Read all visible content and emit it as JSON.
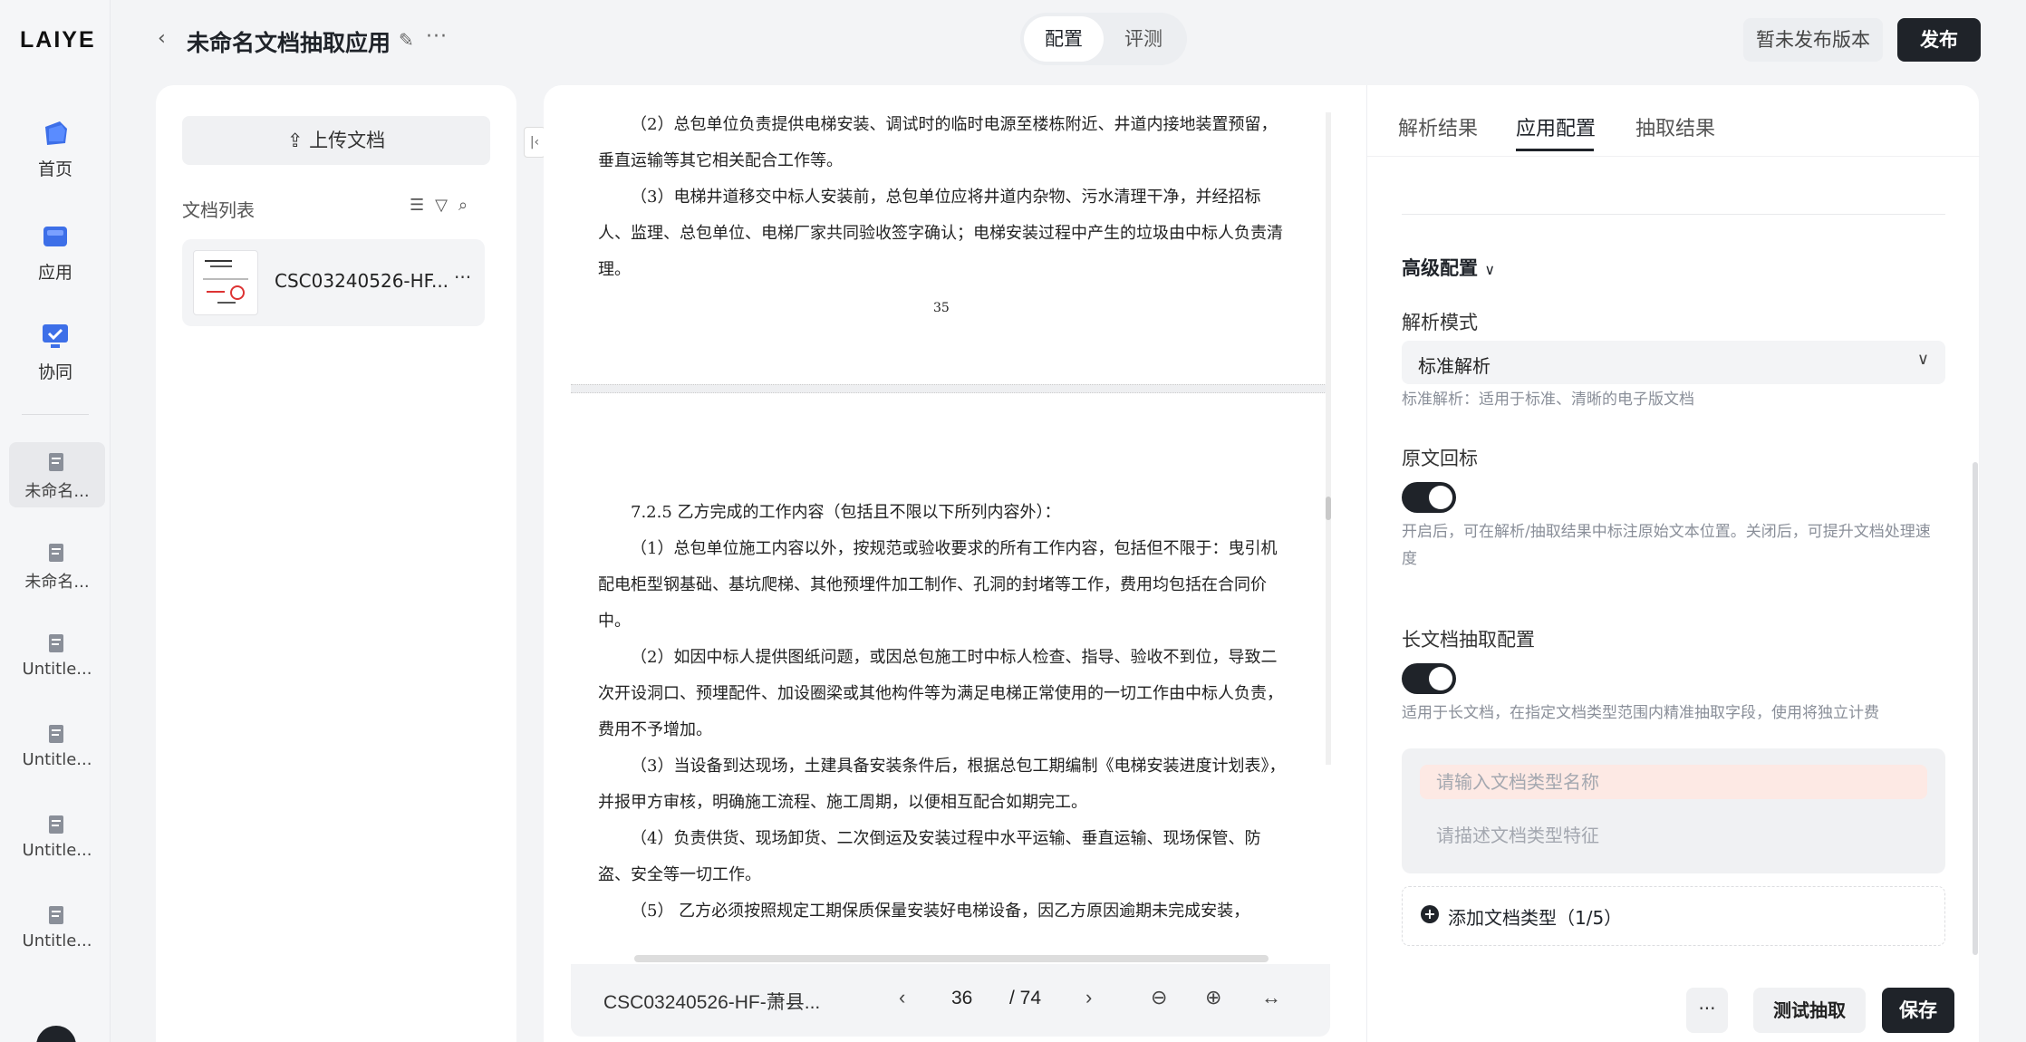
{
  "nav": {
    "logo": "LAIYE",
    "items": [
      {
        "label": "首页",
        "icon": "home-icon"
      },
      {
        "label": "应用",
        "icon": "app-icon"
      },
      {
        "label": "协同",
        "icon": "collab-icon"
      }
    ],
    "docs": [
      {
        "label": "未命名..."
      },
      {
        "label": "未命名..."
      },
      {
        "label": "Untitle..."
      },
      {
        "label": "Untitle..."
      },
      {
        "label": "Untitle..."
      },
      {
        "label": "Untitle..."
      }
    ]
  },
  "header": {
    "back": "‹",
    "title": "未命名文档抽取应用",
    "seg_config": "配置",
    "seg_eval": "评测",
    "version": "暂未发布版本",
    "publish": "发布"
  },
  "list": {
    "upload": "上传文档",
    "title": "文档列表",
    "file_name": "CSC03240526-HF..."
  },
  "viewer": {
    "p1": [
      "（2）总包单位负责提供电梯安装、调试时的临时电源至楼栋附近、井道内接地装置预留，垂直运输等其它相关配合工作等。",
      "（3）电梯井道移交中标人安装前，总包单位应将井道内杂物、污水清理干净，并经招标人、监理、总包单位、电梯厂家共同验收签字确认；电梯安装过程中产生的垃圾由中标人负责清理。"
    ],
    "page_number": "35",
    "p2": [
      "7.2.5 乙方完成的工作内容（包括且不限以下所列内容外）：",
      "（1）总包单位施工内容以外，按规范或验收要求的所有工作内容，包括但不限于：曳引机配电柜型钢基础、基坑爬梯、其他预埋件加工制作、孔洞的封堵等工作，费用均包括在合同价中。",
      "（2）如因中标人提供图纸问题，或因总包施工时中标人检查、指导、验收不到位，导致二次开设洞口、预埋配件、加设圈梁或其他构件等为满足电梯正常使用的一切工作由中标人负责，费用不予增加。",
      "（3）当设备到达现场，土建具备安装条件后，根据总包工期编制《电梯安装进度计划表》，并报甲方审核，明确施工流程、施工周期，以便相互配合如期完工。",
      "（4）负责供货、现场卸货、二次倒运及安装过程中水平运输、垂直运输、现场保管、防盗、安全等一切工作。",
      "（5） 乙方必须按照规定工期保质保量安装好电梯设备，因乙方原因逾期未完成安装，"
    ],
    "footer_file": "CSC03240526-HF-萧县...",
    "current_page": "36",
    "total_pages": "/ 74"
  },
  "right": {
    "tabs": [
      "解析结果",
      "应用配置",
      "抽取结果"
    ],
    "advanced": "高级配置",
    "parse_mode_label": "解析模式",
    "parse_mode_value": "标准解析",
    "parse_mode_hint": "标准解析：适用于标准、清晰的电子版文档",
    "source_label": "原文回标",
    "source_hint": "开启后，可在解析/抽取结果中标注原始文本位置。关闭后，可提升文档处理速度",
    "long_label": "长文档抽取配置",
    "long_hint": "适用于长文档，在指定文档类型范围内精准抽取字段，使用将独立计费",
    "dt_name_placeholder": "请输入文档类型名称",
    "dt_desc_placeholder": "请描述文档类型特征",
    "add_type": "添加文档类型（1/5）",
    "more": "···",
    "test": "测试抽取",
    "save": "保存"
  }
}
